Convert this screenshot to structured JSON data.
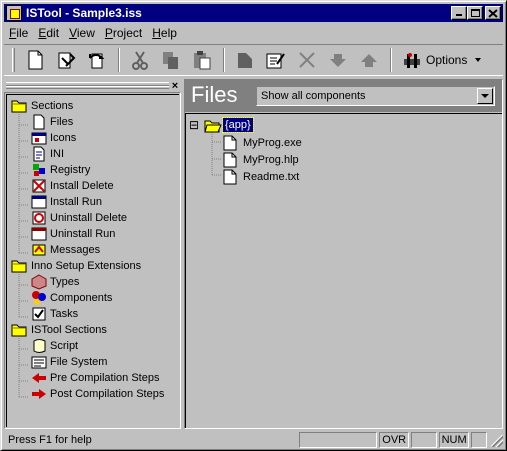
{
  "window": {
    "title": "ISTool - Sample3.iss"
  },
  "menu": {
    "items": [
      {
        "label": "File",
        "accel": "F",
        "rest": "ile"
      },
      {
        "label": "Edit",
        "accel": "E",
        "rest": "dit"
      },
      {
        "label": "View",
        "accel": "V",
        "rest": "iew"
      },
      {
        "label": "Project",
        "accel": "P",
        "rest": "roject"
      },
      {
        "label": "Help",
        "accel": "H",
        "rest": "elp"
      }
    ]
  },
  "toolbar": {
    "buttons": [
      "new-file-icon",
      "save-icon",
      "revert-icon",
      "cut-icon",
      "copy-icon",
      "paste-icon",
      "new-item-icon",
      "edit-item-icon",
      "delete-icon",
      "move-down-icon",
      "move-up-icon"
    ],
    "options_label": "Options"
  },
  "sidebar": {
    "close": "×",
    "groups": [
      {
        "label": "Sections",
        "items": [
          "Files",
          "Icons",
          "INI",
          "Registry",
          "Install Delete",
          "Install Run",
          "Uninstall Delete",
          "Uninstall Run",
          "Messages"
        ]
      },
      {
        "label": "Inno Setup Extensions",
        "items": [
          "Types",
          "Components",
          "Tasks"
        ]
      },
      {
        "label": "ISTool Sections",
        "items": [
          "Script",
          "File System",
          "Pre Compilation Steps",
          "Post Compilation Steps"
        ]
      }
    ]
  },
  "main": {
    "title": "Files",
    "filter": {
      "value": "Show all components"
    },
    "tree": {
      "expander": "⊟",
      "root": "{app}",
      "files": [
        "MyProg.exe",
        "MyProg.hlp",
        "Readme.txt"
      ]
    }
  },
  "status": {
    "help": "Press F1 for help",
    "ovr": "OVR",
    "num": "NUM"
  },
  "colors": {
    "titlebar": "#000080",
    "face": "#c0c0c0",
    "header": "#808080",
    "folder": "#ffff00"
  }
}
